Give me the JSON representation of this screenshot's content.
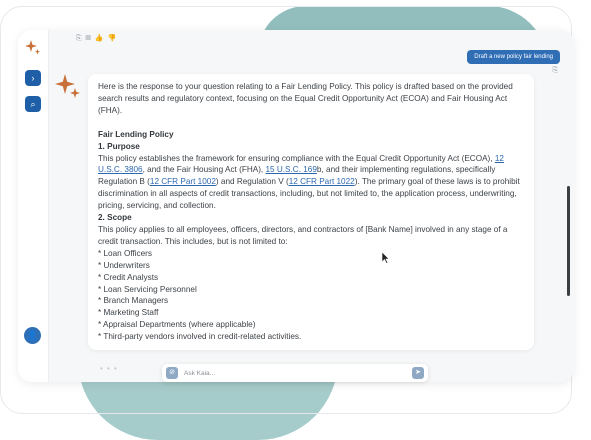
{
  "colors": {
    "accent": "#2f6db5",
    "teal_background": "#7fb3b3",
    "link": "#2c68b0",
    "sparkle": "#c8703a"
  },
  "sidebar": {
    "logo_icon": "sparkle-icon",
    "items": [
      {
        "icon": "chevron-right-icon",
        "glyph": "›"
      },
      {
        "icon": "search-icon",
        "glyph": "⌕"
      }
    ],
    "profile": {
      "icon": "user-icon",
      "glyph": "👤"
    }
  },
  "toolbar": {
    "icons": [
      "copy-icon",
      "document-icon",
      "thumbs-up-icon",
      "thumbs-down-icon"
    ],
    "glyphs": "⎘ ▤ 👍 👎"
  },
  "user_message": {
    "text": "Draft a new policy fair lending",
    "copy_glyph": "⎘"
  },
  "response": {
    "intro": "Here is the response to your question relating to a Fair Lending Policy. This policy is drafted based on the provided search results and regulatory context, focusing on the Equal Credit Opportunity Act (ECOA) and Fair Housing Act (FHA).",
    "title": "Fair Lending Policy",
    "section1_heading": "1. Purpose",
    "purpose": {
      "t1": "This policy establishes the framework for ensuring compliance with the Equal Credit Opportunity Act (ECOA), ",
      "link1": "12 U.S.C. 3806",
      "t2": ", and the Fair Housing Act (FHA), ",
      "link2": "15 U.S.C. 169",
      "t3": "b, and their implementing regulations, specifically Regulation B (",
      "link3": "12 CFR Part 1002",
      "t4": ") and Regulation V (",
      "link4": "12 CFR Part 1022",
      "t5": "). The primary goal of these laws is to prohibit discrimination in all aspects of credit transactions, including, but not limited to, the application process, underwriting, pricing, servicing, and collection."
    },
    "section2_heading": "2. Scope",
    "scope_intro": "This policy applies to all employees, officers, directors, and contractors of [Bank Name] involved in any stage of a credit transaction. This includes, but is not limited to:",
    "scope_items": [
      "* Loan Officers",
      "* Underwriters",
      "* Credit Analysts",
      "* Loan Servicing Personnel",
      "* Branch Managers",
      "* Marketing Staff",
      "* Appraisal Departments (where applicable)",
      "* Third-party vendors involved in credit-related activities."
    ]
  },
  "input": {
    "placeholder": "Ask Kaia...",
    "attach_icon": "attachment-icon",
    "attach_glyph": "⊘",
    "send_icon": "send-icon",
    "send_glyph": "➤"
  },
  "typing_indicator": "• • •"
}
